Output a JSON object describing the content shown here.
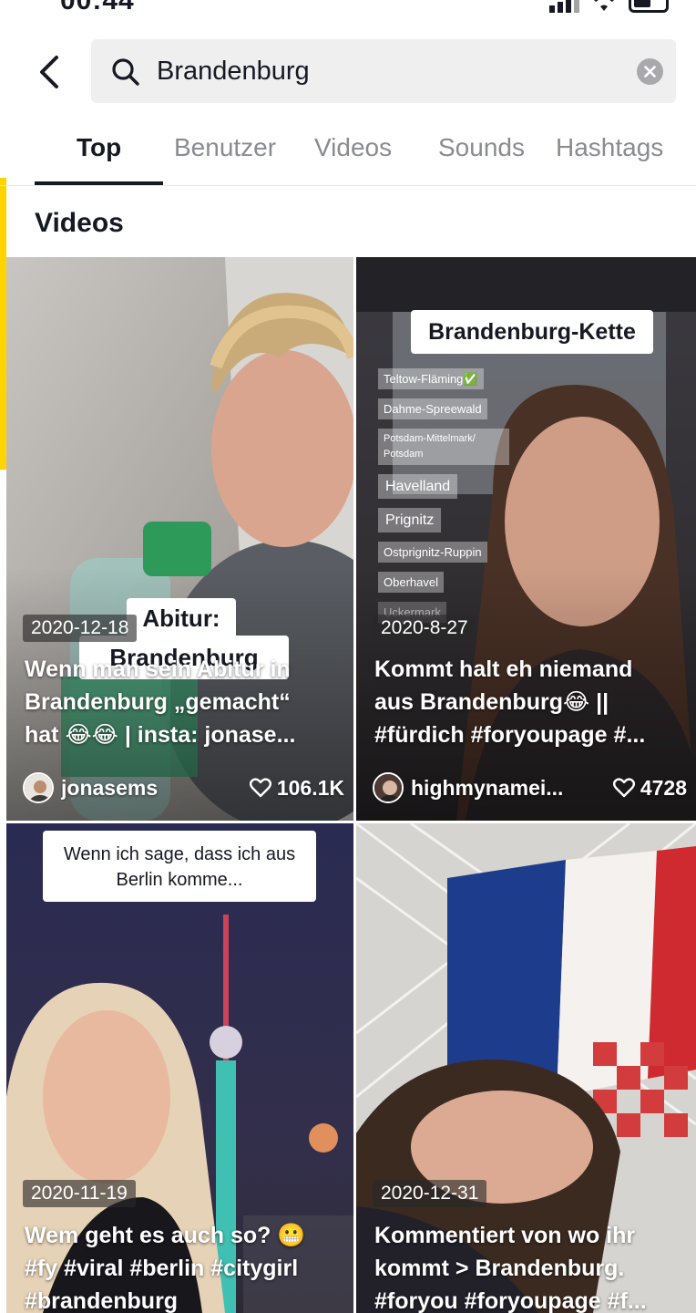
{
  "status_bar": {
    "time": "00:44"
  },
  "search": {
    "query": "Brandenburg"
  },
  "tabs": [
    {
      "label": "Top",
      "active": true
    },
    {
      "label": "Benutzer",
      "active": false
    },
    {
      "label": "Videos",
      "active": false
    },
    {
      "label": "Sounds",
      "active": false
    },
    {
      "label": "Hashtags",
      "active": false
    }
  ],
  "section": {
    "title": "Videos"
  },
  "videos": [
    {
      "date": "2020-12-18",
      "caption": "Wenn man sein Abitur in\nBrandenburg „gemacht“\nhat 😂😂 | insta: jonase...",
      "username": "jonasems",
      "likes": "106.1K",
      "overlay_text": [
        "Abitur:",
        "Brandenburg"
      ]
    },
    {
      "date": "2020-8-27",
      "caption": "Kommt halt eh niemand\naus Brandenburg😂 ||\n#fürdich #foryoupage #...",
      "username": "highmynamei...",
      "likes": "4728",
      "overlay_title": "Brandenburg-Kette",
      "overlay_list": [
        "Teltow-Fläming✅",
        "Dahme-Spreewald",
        "Potsdam-Mittelmark/\nPotsdam",
        "Havelland",
        "Prignitz",
        "Ostprignitz-Ruppin",
        "Oberhavel",
        "Uckermark"
      ]
    },
    {
      "date": "2020-11-19",
      "caption": "Wem geht es auch so? 😬\n#fy #viral #berlin #citygirl\n#brandenburg",
      "overlay_text": [
        "Wenn ich sage, dass ich aus",
        "Berlin komme..."
      ]
    },
    {
      "date": "2020-12-31",
      "caption": "Kommentiert von wo ihr\nkommt  > Brandenburg.\n#foryou #foryoupage #f..."
    }
  ],
  "colors": {
    "text": "#161823",
    "muted": "#8a8b91",
    "search_bg": "#efeff0",
    "accent_strip": "#ffd400"
  },
  "icons": {
    "back": "chevron-left-icon",
    "search": "search-icon",
    "clear": "clear-icon",
    "like": "heart-icon"
  }
}
